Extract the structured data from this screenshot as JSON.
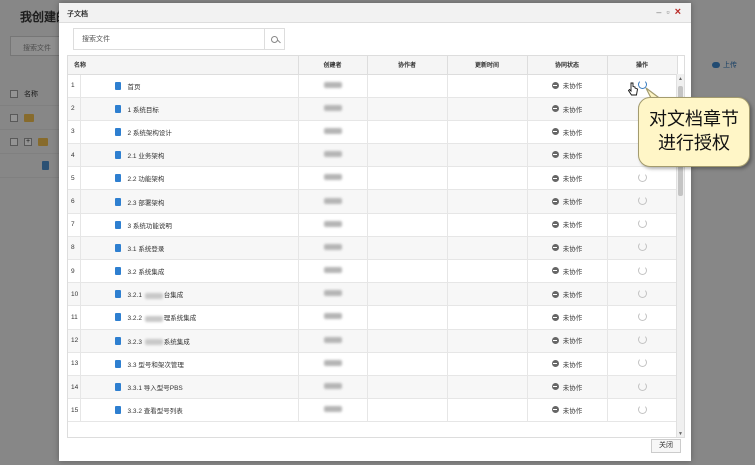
{
  "background": {
    "title": "我创建的",
    "search_placeholder": "搜索文件",
    "column_name": "名称",
    "upload_label": "上传"
  },
  "modal": {
    "title": "子文档",
    "search_placeholder": "搜索文件",
    "close_button": "关闭",
    "columns": [
      "名称",
      "创建者",
      "协作者",
      "更新时间",
      "协同状态",
      "操作"
    ],
    "rows": [
      {
        "index": "1",
        "name": "首页",
        "status": "未协作"
      },
      {
        "index": "2",
        "name": "1 系统目标",
        "status": "未协作"
      },
      {
        "index": "3",
        "name": "2 系统架构设计",
        "status": "未协作"
      },
      {
        "index": "4",
        "name": "2.1 业务架构",
        "status": "未协作"
      },
      {
        "index": "5",
        "name": "2.2 功能架构",
        "status": "未协作"
      },
      {
        "index": "6",
        "name": "2.3 部署架构",
        "status": "未协作"
      },
      {
        "index": "7",
        "name": "3 系统功能说明",
        "status": "未协作"
      },
      {
        "index": "8",
        "name": "3.1 系统登录",
        "status": "未协作"
      },
      {
        "index": "9",
        "name": "3.2 系统集成",
        "status": "未协作"
      },
      {
        "index": "10",
        "name_prefix": "3.2.1",
        "name_suffix": "台集成",
        "status": "未协作"
      },
      {
        "index": "11",
        "name_prefix": "3.2.2",
        "name_suffix": "理系统集成",
        "status": "未协作"
      },
      {
        "index": "12",
        "name_prefix": "3.2.3",
        "name_suffix": "系统集成",
        "status": "未协作"
      },
      {
        "index": "13",
        "name": "3.3 型号和架次管理",
        "status": "未协作"
      },
      {
        "index": "14",
        "name": "3.3.1 导入型号PBS",
        "status": "未协作"
      },
      {
        "index": "15",
        "name": "3.3.2 查看型号列表",
        "status": "未协作"
      }
    ]
  },
  "callout": {
    "line1": "对文档章节",
    "line2": "进行授权"
  },
  "colors": {
    "doc_icon": "#2e7fd0",
    "close_x": "#b92b27",
    "callout_bg": "#fff6c7"
  }
}
